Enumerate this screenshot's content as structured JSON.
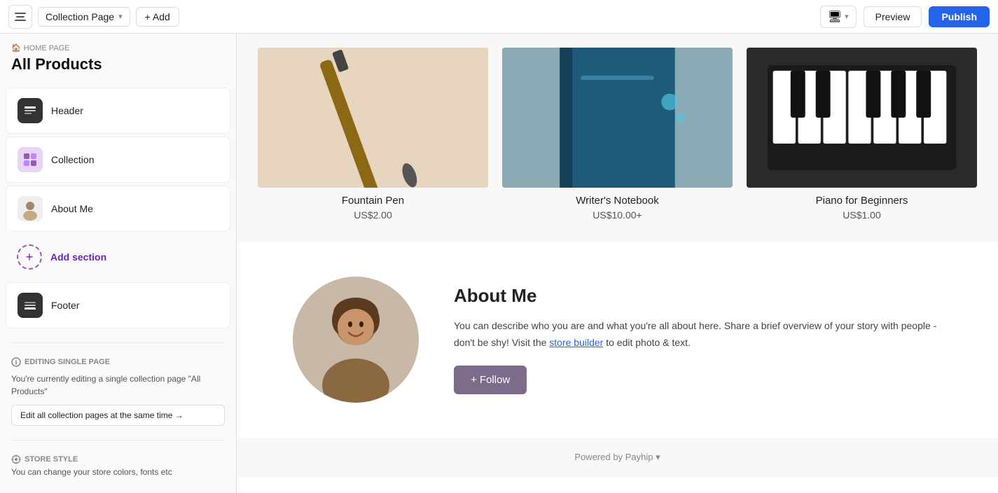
{
  "topbar": {
    "menu_label": "☰",
    "page_name": "Collection Page",
    "chevron": "▾",
    "add_label": "+ Add",
    "device_icon": "🖥",
    "preview_label": "Preview",
    "publish_label": "Publish"
  },
  "sidebar": {
    "breadcrumb": "🏠 HOME PAGE",
    "title": "All Products",
    "sections": [
      {
        "id": "header",
        "label": "Header",
        "icon_type": "header"
      },
      {
        "id": "collection",
        "label": "Collection",
        "icon_type": "collection"
      },
      {
        "id": "aboutme",
        "label": "About Me",
        "icon_type": "aboutme"
      },
      {
        "id": "footer",
        "label": "Footer",
        "icon_type": "footer"
      }
    ],
    "add_section_label": "Add section",
    "editing_label": "EDITING SINGLE PAGE",
    "editing_info": "You're currently editing a single collection page \"All Products\"",
    "edit_all_btn": "Edit all collection pages at the same time →",
    "store_style_label": "STORE STYLE",
    "store_style_desc": "You can change your store colors, fonts etc"
  },
  "products": [
    {
      "name": "Fountain Pen",
      "price": "US$2.00"
    },
    {
      "name": "Writer's Notebook",
      "price": "US$10.00+"
    },
    {
      "name": "Piano for Beginners",
      "price": "US$1.00"
    }
  ],
  "about": {
    "title": "About Me",
    "description_part1": "You can describe who you are and what you're all about here. Share a brief overview of your story with people - don't be shy! Visit the ",
    "link_text": "store builder",
    "description_part2": " to edit photo & text.",
    "follow_label": "+ Follow"
  },
  "footer": {
    "powered_by": "Powered by",
    "brand": "Payhip",
    "chevron": "▾"
  }
}
